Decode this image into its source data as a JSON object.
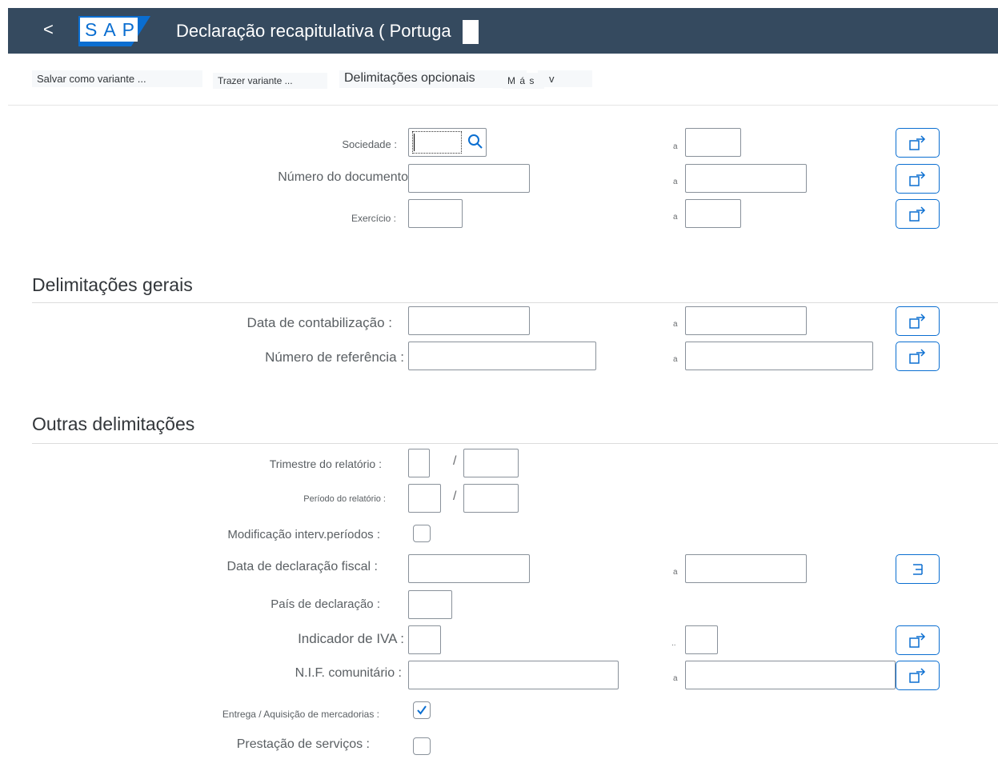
{
  "shell": {
    "back_label": "<",
    "logo_text": "SAP",
    "title": "Declaração recapitulativa ( Portuga"
  },
  "toolbar": {
    "save_variant": "Salvar como variante ...",
    "get_variant": "Trazer variante ...",
    "optional_label": "Delimitações opcionais",
    "more_label": "M á s",
    "more_chevron": "v"
  },
  "fields": {
    "company": "Sociedade :",
    "doc_number": "Número do documento",
    "doc_number_colon": ":",
    "fiscal_year": "Exercício :",
    "to": "a",
    "to_dots": ".."
  },
  "general": {
    "heading": "Delimitações gerais",
    "posting_date": "Data de contabilização :",
    "reference": "Número de referência :"
  },
  "other": {
    "heading": "Outras delimitações",
    "quarter": "Trimestre do relatório :",
    "period": "Período do relatório :",
    "slash": "/",
    "period_change": "Modificação interv.períodos :",
    "tax_date": "Data de declaração fiscal :",
    "country": "País de declaração :",
    "vat_indicator": "Indicador de IVA :",
    "vat_id": "N.I.F. comunitário :",
    "goods": "Entrega / Aquisição de mercadorias :",
    "services": "Prestação de serviços :"
  },
  "checkboxes": {
    "period_change": false,
    "goods": true,
    "services": false
  },
  "colors": {
    "shell": "#354a5f",
    "accent": "#0a6ed1",
    "logo_blue": "#0a6ed1"
  }
}
